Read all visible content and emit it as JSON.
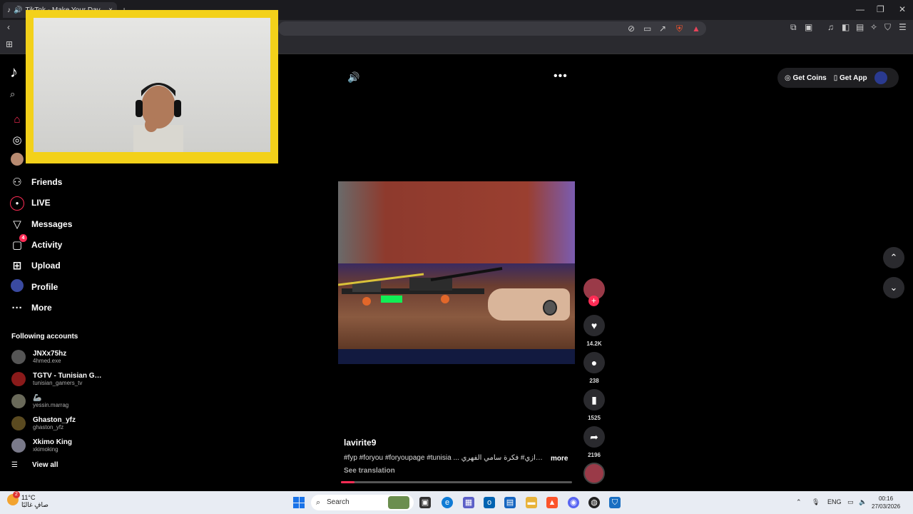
{
  "browser": {
    "tab_title": "TikTok - Make Your Day",
    "tab_close": "×",
    "new_tab": "+"
  },
  "sidebar": {
    "nav": [
      {
        "label": "Friends",
        "icon": "friends-icon"
      },
      {
        "label": "LIVE",
        "icon": "live-icon"
      },
      {
        "label": "Messages",
        "icon": "messages-icon"
      },
      {
        "label": "Activity",
        "icon": "activity-icon",
        "badge": "4"
      },
      {
        "label": "Upload",
        "icon": "upload-icon"
      },
      {
        "label": "Profile",
        "icon": "profile-icon"
      },
      {
        "label": "More",
        "icon": "more-icon"
      }
    ],
    "following_title": "Following accounts",
    "following": [
      {
        "name": "JNXx75hz",
        "username": "4hmed.exe"
      },
      {
        "name": "TGTV - Tunisian Ga...",
        "username": "tunisian_gamers_tv"
      },
      {
        "name": "🦾",
        "username": "yessin.marrag"
      },
      {
        "name": "Ghaston_yfz",
        "username": "ghaston_yfz"
      },
      {
        "name": "Xkimo King",
        "username": "xkimoking"
      }
    ],
    "view_all": "View all"
  },
  "header": {
    "get_coins": "Get Coins",
    "get_app": "Get App"
  },
  "video": {
    "author": "lavirite9",
    "caption": "#fyp #foryou #foryoupage #tunisia ... بابارازي# فكرة سامي الفهري",
    "more": "more",
    "see_translation": "See translation",
    "progress": 0.06,
    "likes": "14.2K",
    "comments": "238",
    "saves": "1525",
    "shares": "2196"
  },
  "taskbar": {
    "temperature": "11°C",
    "weather_text": "صافٍ غالبًا",
    "weather_badge": "2",
    "search_placeholder": "Search",
    "language": "ENG",
    "time": "00:16",
    "date": "27/03/2026"
  },
  "colors": {
    "accent": "#fe2c55",
    "webcam_frame": "#f3d11a"
  }
}
